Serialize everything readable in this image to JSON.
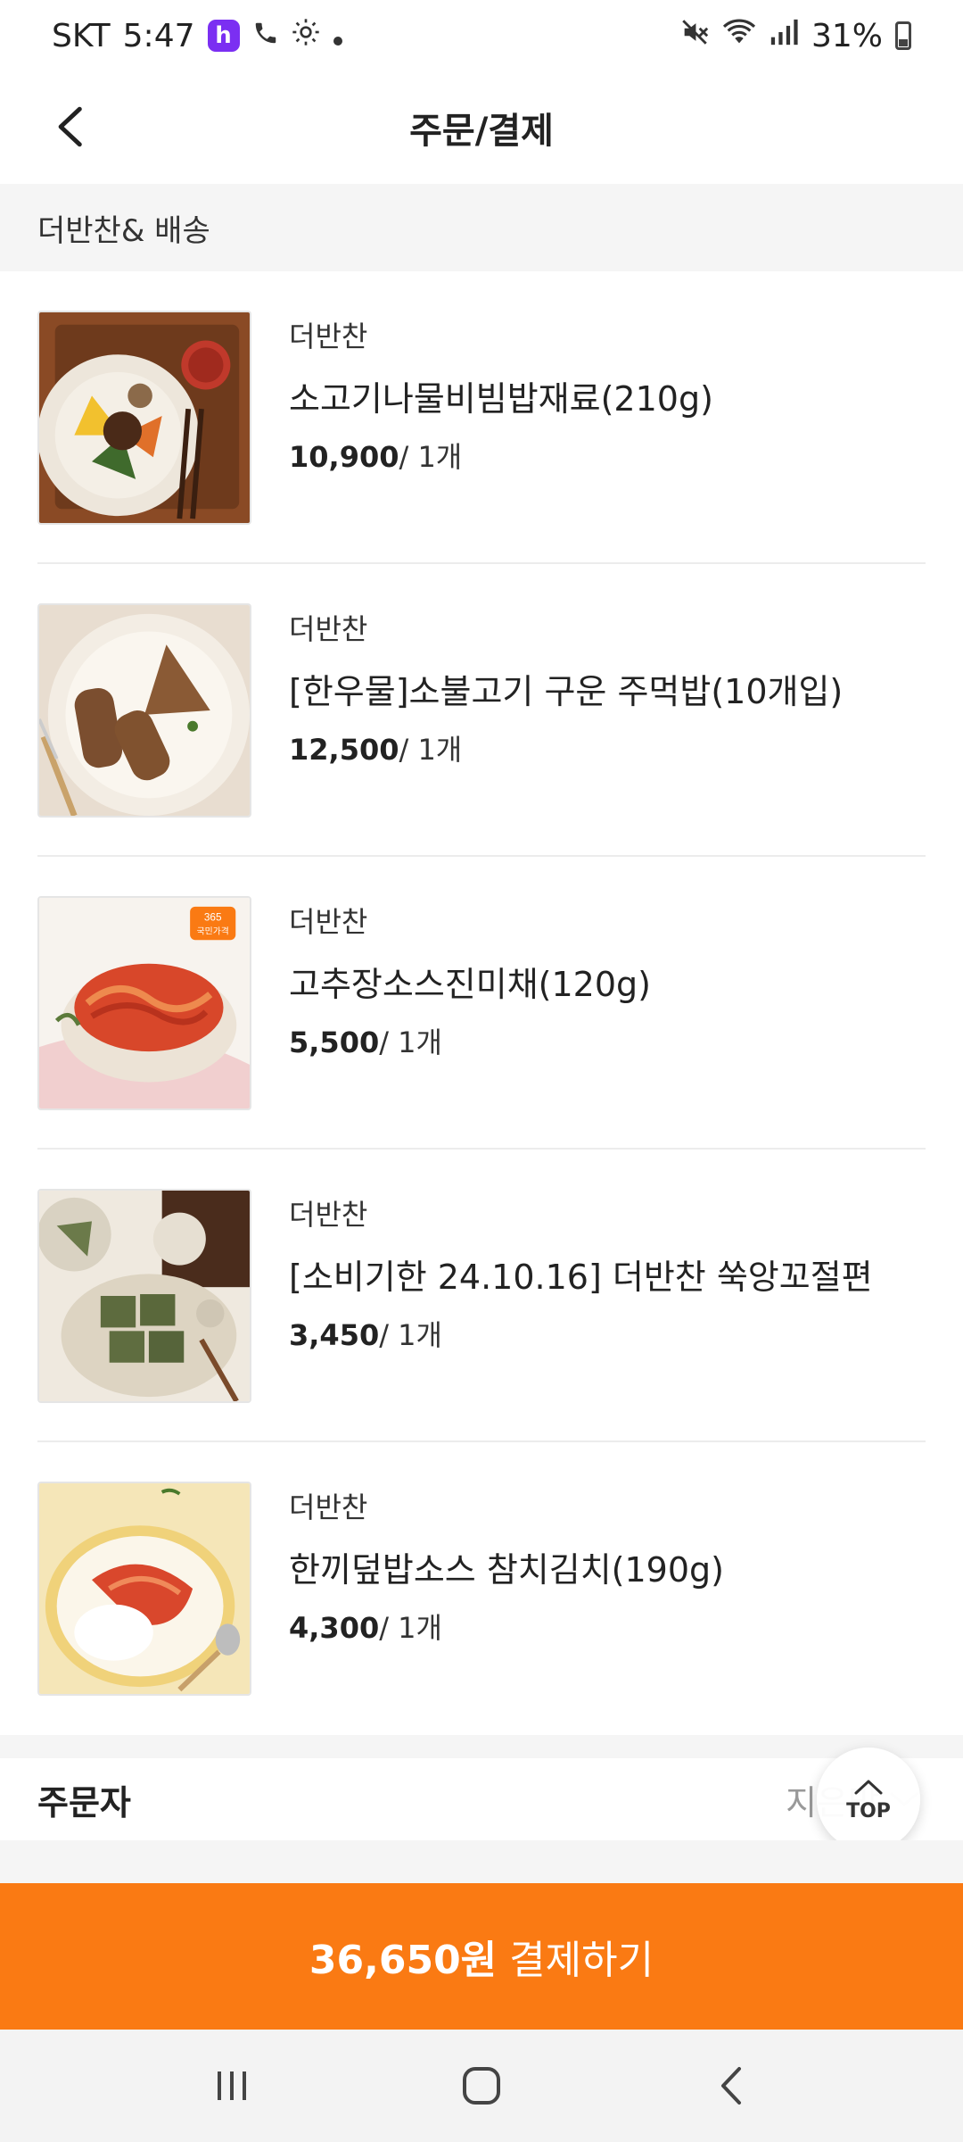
{
  "status_bar": {
    "carrier": "SKT",
    "time": "5:47",
    "app_badge": "h",
    "battery": "31%"
  },
  "header": {
    "title": "주문/결제"
  },
  "section": {
    "title": "더반찬& 배송"
  },
  "products": [
    {
      "brand": "더반찬",
      "name": "소고기나물비빔밥재료(210g)",
      "price": "10,900",
      "qty": "/ 1개"
    },
    {
      "brand": "더반찬",
      "name": "[한우물]소불고기 구운 주먹밥(10개입)",
      "price": "12,500",
      "qty": "/ 1개"
    },
    {
      "brand": "더반찬",
      "name": "고추장소스진미채(120g)",
      "price": "5,500",
      "qty": "/ 1개",
      "badge_line1": "365",
      "badge_line2": "국민가격"
    },
    {
      "brand": "더반찬",
      "name": "[소비기한 24.10.16] 더반찬 쑥앙꼬절편",
      "price": "3,450",
      "qty": "/ 1개"
    },
    {
      "brand": "더반찬",
      "name": "한끼덮밥소스 참치김치(190g)",
      "price": "4,300",
      "qty": "/ 1개"
    }
  ],
  "orderer": {
    "label": "주문자",
    "value": "지은맘"
  },
  "top_button": {
    "label": "TOP"
  },
  "pay": {
    "amount": "36,650원",
    "label": "결제하기"
  },
  "colors": {
    "accent": "#fa7a13",
    "app_badge": "#7b2ff2"
  }
}
